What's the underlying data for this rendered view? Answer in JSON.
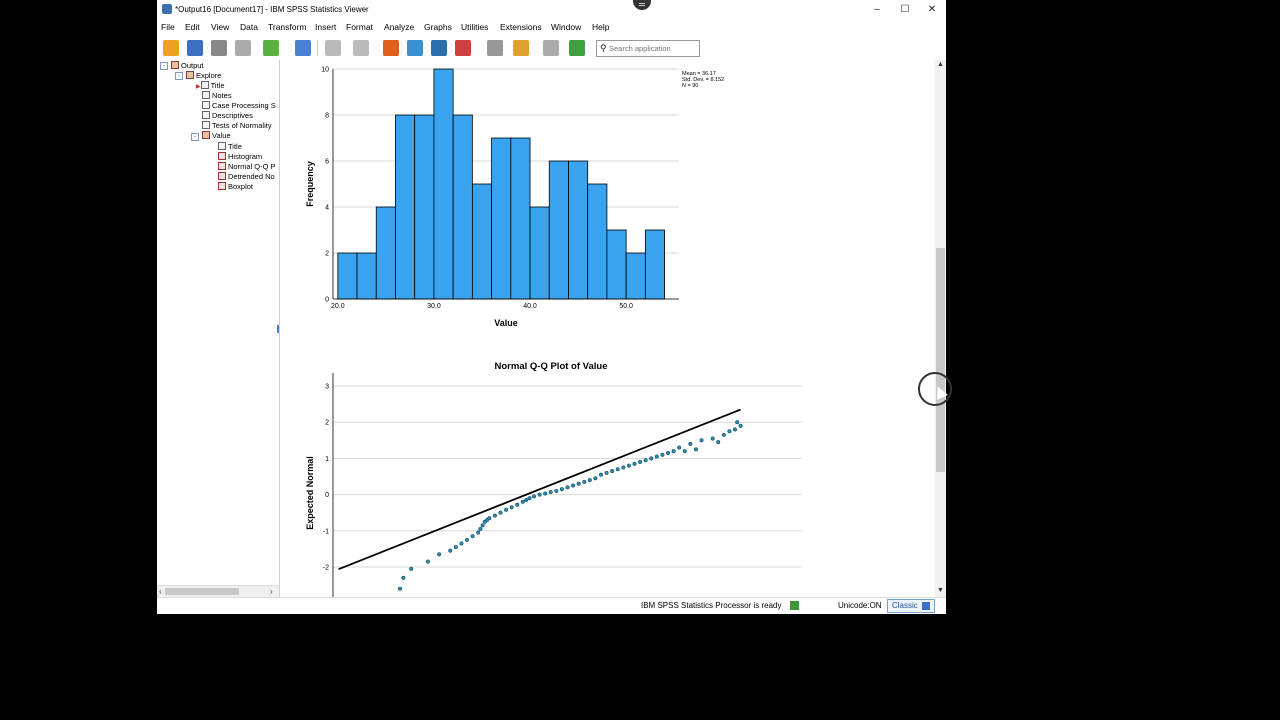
{
  "window": {
    "title": "*Output16 [Document17] - IBM SPSS Statistics Viewer",
    "controls": [
      "minimize-icon",
      "maximize-icon",
      "close-icon"
    ]
  },
  "menu": [
    "File",
    "Edit",
    "View",
    "Data",
    "Transform",
    "Insert",
    "Format",
    "Analyze",
    "Graphs",
    "Utilities",
    "Extensions",
    "Window",
    "Help"
  ],
  "toolbar": {
    "icons": [
      "open-icon",
      "save-icon",
      "print-icon",
      "print-preview-icon",
      "export-icon",
      "recall-dialog-icon",
      "undo-icon",
      "redo-icon",
      "goto-data-icon",
      "goto-case-icon",
      "goto-variable-icon",
      "variables-icon",
      "show-all-variables-icon",
      "designate-window-icon",
      "create-edit-autoscript-icon",
      "run-script-icon",
      "insert-output-icon"
    ],
    "search_placeholder": "Search application"
  },
  "nav_tree": [
    {
      "label": "Output",
      "level": 0,
      "icon": "book-icon",
      "expander": "-"
    },
    {
      "label": "Explore",
      "level": 1,
      "icon": "book-icon",
      "expander": "-"
    },
    {
      "label": "Title",
      "level": 2,
      "icon": "title-icon"
    },
    {
      "label": "Notes",
      "level": 2,
      "icon": "notes-icon"
    },
    {
      "label": "Case Processing S",
      "level": 2,
      "icon": "table-icon"
    },
    {
      "label": "Descriptives",
      "level": 2,
      "icon": "table-icon"
    },
    {
      "label": "Tests of Normality",
      "level": 2,
      "icon": "table-icon"
    },
    {
      "label": "Value",
      "level": 2,
      "icon": "book-icon",
      "expander": "-"
    },
    {
      "label": "Title",
      "level": 3,
      "icon": "title-icon"
    },
    {
      "label": "Histogram",
      "level": 3,
      "icon": "chart-icon"
    },
    {
      "label": "Normal Q-Q P",
      "level": 3,
      "icon": "chart-icon"
    },
    {
      "label": "Detrended No",
      "level": 3,
      "icon": "chart-icon"
    },
    {
      "label": "Boxplot",
      "level": 3,
      "icon": "chart-icon"
    }
  ],
  "status": {
    "processor": "IBM SPSS Statistics Processor is ready",
    "unicode": "Unicode:ON",
    "mode": "Classic"
  },
  "chart_data": [
    {
      "type": "bar",
      "title": "",
      "xlabel": "Value",
      "ylabel": "Frequency",
      "stats": [
        "Mean = 36.17",
        "Std. Dev. = 8.152",
        "N = 90"
      ],
      "bin_width": 2,
      "bins_start": [
        21,
        23,
        25,
        27,
        29,
        31,
        33,
        35,
        37,
        39,
        41,
        43,
        45,
        47,
        49,
        51
      ],
      "values": [
        2,
        2,
        4,
        8,
        8,
        10,
        8,
        5,
        7,
        7,
        4,
        6,
        6,
        5,
        3,
        2,
        3
      ],
      "xticks": [
        "20.0",
        "30.0",
        "40.0",
        "50.0"
      ],
      "xtick_values": [
        20,
        30,
        40,
        50
      ],
      "yticks": [
        "0",
        "2",
        "4",
        "6",
        "8",
        "10"
      ],
      "xlim": [
        19.5,
        55.5
      ],
      "ylim": [
        0,
        10
      ],
      "grid": true,
      "color": "#3aa3f0"
    },
    {
      "type": "scatter",
      "title": "Normal Q-Q Plot of Value",
      "xlabel": "",
      "ylabel": "Expected Normal",
      "yticks": [
        "3",
        "2",
        "1",
        "0",
        "-1",
        "-2"
      ],
      "ytick_values": [
        3,
        2,
        1,
        0,
        -1,
        -2
      ],
      "xlim": [
        16,
        58
      ],
      "ylim": [
        -2.2,
        3
      ],
      "grid": true,
      "point_color": "#2a8ab0",
      "reference_line": [
        [
          16.5,
          -2.06
        ],
        [
          52.5,
          2.35
        ]
      ],
      "x": [
        22,
        22.3,
        23,
        24.5,
        25.5,
        26.5,
        27,
        27.5,
        28,
        28.5,
        29,
        29.2,
        29.4,
        29.6,
        29.8,
        30,
        30.5,
        31,
        31.5,
        32,
        32.5,
        33,
        33.3,
        33.6,
        34,
        34.5,
        35,
        35.5,
        36,
        36.5,
        37,
        37.5,
        38,
        38.5,
        39,
        39.5,
        40,
        40.5,
        41,
        41.5,
        42,
        42.5,
        43,
        43.5,
        44,
        44.5,
        45,
        45.5,
        46,
        46.5,
        47,
        48,
        49,
        50,
        51,
        52,
        52.5,
        52.2,
        51.5,
        50.5,
        48.5,
        47.5
      ],
      "y": [
        -2.6,
        -2.3,
        -2.05,
        -1.85,
        -1.65,
        -1.55,
        -1.45,
        -1.35,
        -1.25,
        -1.15,
        -1.05,
        -0.95,
        -0.85,
        -0.75,
        -0.7,
        -0.65,
        -0.58,
        -0.5,
        -0.42,
        -0.35,
        -0.28,
        -0.2,
        -0.15,
        -0.1,
        -0.05,
        0,
        0.03,
        0.07,
        0.1,
        0.15,
        0.2,
        0.25,
        0.3,
        0.35,
        0.4,
        0.45,
        0.55,
        0.6,
        0.65,
        0.7,
        0.75,
        0.8,
        0.85,
        0.9,
        0.95,
        1.0,
        1.05,
        1.1,
        1.15,
        1.2,
        1.3,
        1.4,
        1.5,
        1.55,
        1.65,
        1.8,
        1.9,
        2.0,
        1.75,
        1.45,
        1.25,
        1.2
      ]
    }
  ]
}
